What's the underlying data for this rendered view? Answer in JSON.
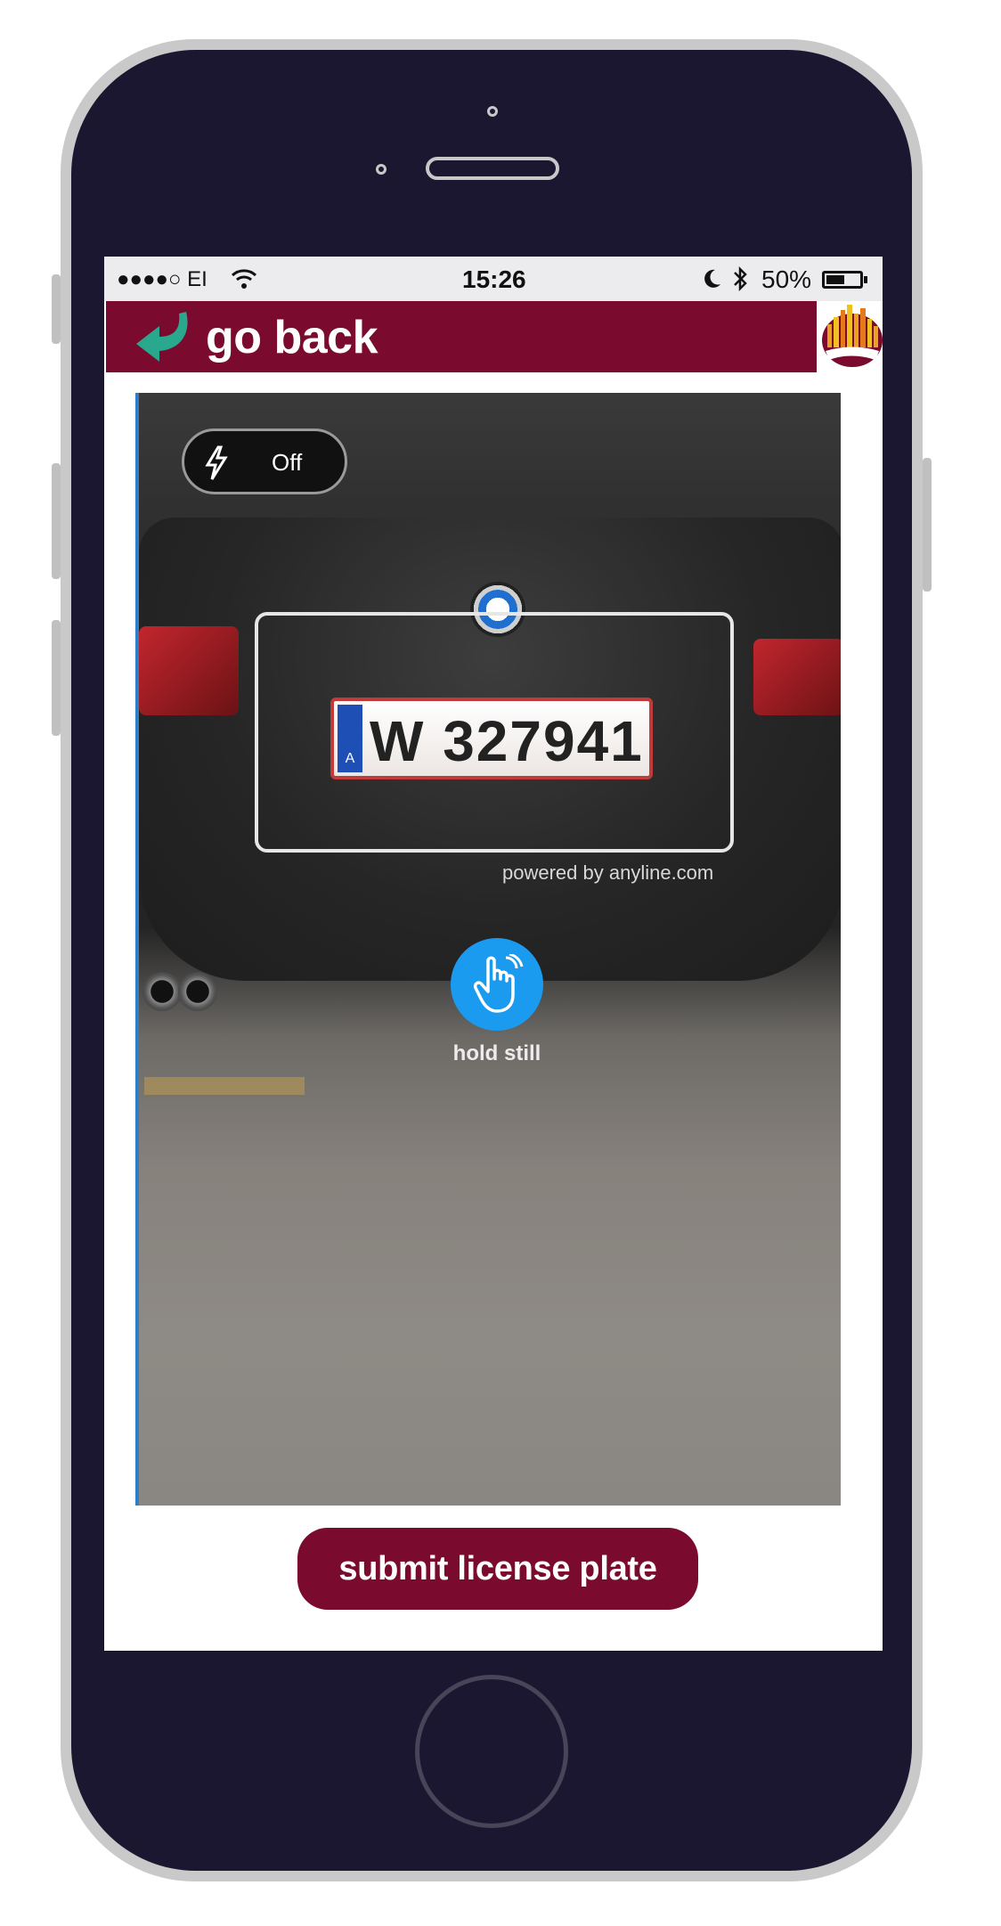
{
  "status_bar": {
    "signal": "●●●●○ EI",
    "wifi_icon": "wifi-icon",
    "time": "15:26",
    "moon_icon": "moon-icon",
    "bluetooth_icon": "bluetooth-icon",
    "battery_percent": "50%",
    "battery_level": 0.5
  },
  "header": {
    "back_label": "go back",
    "back_icon": "return-arrow-icon",
    "logo_icon": "city-skyline-logo",
    "bar_color": "#7a0a2e",
    "arrow_color": "#2aa88e"
  },
  "scanner": {
    "torch_label": "Off",
    "torch_icon": "lightning-icon",
    "plate_text": "W 327941",
    "plate_country": "A",
    "powered_by": "powered by anyline.com",
    "hint_label": "hold still",
    "hint_icon": "hand-tap-icon",
    "hint_color": "#1a9bf0"
  },
  "actions": {
    "submit_label": "submit license plate"
  }
}
